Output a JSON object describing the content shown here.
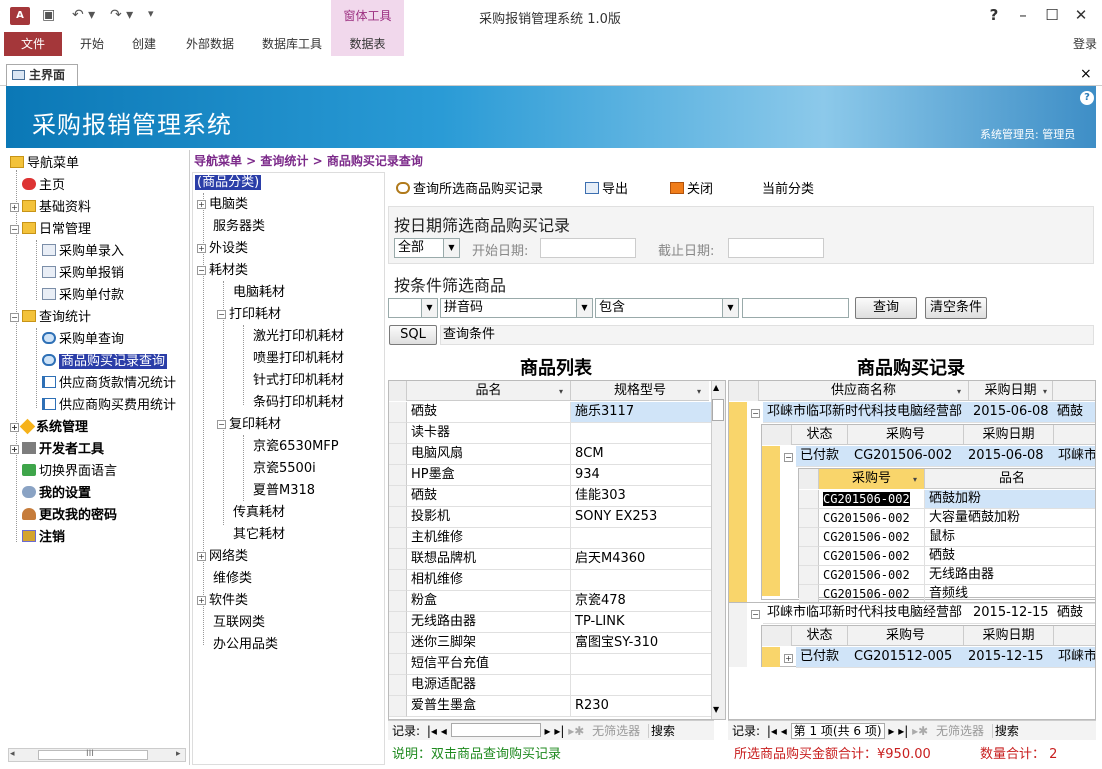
{
  "titlebar": {
    "app_icon": "A",
    "context_tab": "窗体工具",
    "window_title": "采购报销管理系统 1.0版",
    "help": "?",
    "minimize": "–",
    "maximize": "☐",
    "close": "✕"
  },
  "ribbon": {
    "file": "文件",
    "tabs": [
      "开始",
      "创建",
      "外部数据",
      "数据库工具",
      "数据表"
    ],
    "login": "登录"
  },
  "doc_tab": {
    "label": "主界面",
    "close": "×"
  },
  "banner": {
    "title": "采购报销管理系统",
    "user": "系统管理员: 管理员",
    "help": "?"
  },
  "nav": {
    "items": [
      {
        "label": "导航菜单",
        "icon": "folder-icon",
        "level": 0,
        "expander": ""
      },
      {
        "label": "主页",
        "icon": "bug-icon",
        "level": 1,
        "expander": ""
      },
      {
        "label": "基础资料",
        "icon": "folder-icon",
        "level": 1,
        "expander": "+"
      },
      {
        "label": "日常管理",
        "icon": "folder-icon",
        "level": 1,
        "expander": "−"
      },
      {
        "label": "采购单录入",
        "icon": "edit-icon",
        "level": 2,
        "expander": ""
      },
      {
        "label": "采购单报销",
        "icon": "edit-icon",
        "level": 2,
        "expander": ""
      },
      {
        "label": "采购单付款",
        "icon": "pay-icon",
        "level": 2,
        "expander": ""
      },
      {
        "label": "查询统计",
        "icon": "folder-icon",
        "level": 1,
        "expander": "−"
      },
      {
        "label": "采购单查询",
        "icon": "search-icon",
        "level": 2,
        "expander": ""
      },
      {
        "label": "商品购买记录查询",
        "icon": "search-icon",
        "level": 2,
        "expander": "",
        "selected": true
      },
      {
        "label": "供应商货款情况统计",
        "icon": "chart-icon",
        "level": 2,
        "expander": ""
      },
      {
        "label": "供应商购买费用统计",
        "icon": "chart-icon",
        "level": 2,
        "expander": ""
      },
      {
        "label": "系统管理",
        "icon": "star-icon",
        "level": 1,
        "expander": "+",
        "bold": true
      },
      {
        "label": "开发者工具",
        "icon": "tool-icon",
        "level": 1,
        "expander": "+",
        "bold": true
      },
      {
        "label": "切换界面语言",
        "icon": "language-icon",
        "level": 1,
        "expander": ""
      },
      {
        "label": "我的设置",
        "icon": "gear-icon",
        "level": 1,
        "expander": "",
        "bold": true
      },
      {
        "label": "更改我的密码",
        "icon": "user-icon",
        "level": 1,
        "expander": "",
        "bold": true
      },
      {
        "label": "注销",
        "icon": "exit-icon",
        "level": 1,
        "expander": "",
        "bold": true
      }
    ],
    "scroll_mark": "III"
  },
  "breadcrumb": "导航菜单 > 查询统计 > 商品购买记录查询",
  "categories": {
    "items": [
      {
        "label": "(商品分类)",
        "level": 0,
        "expander": "",
        "selected": true
      },
      {
        "label": "电脑类",
        "level": 1,
        "expander": "+"
      },
      {
        "label": "服务器类",
        "level": 1,
        "expander": ""
      },
      {
        "label": "外设类",
        "level": 1,
        "expander": "+"
      },
      {
        "label": "耗材类",
        "level": 1,
        "expander": "−"
      },
      {
        "label": "电脑耗材",
        "level": 2,
        "expander": ""
      },
      {
        "label": "打印耗材",
        "level": 2,
        "expander": "−"
      },
      {
        "label": "激光打印机耗材",
        "level": 3,
        "expander": ""
      },
      {
        "label": "喷墨打印机耗材",
        "level": 3,
        "expander": ""
      },
      {
        "label": "针式打印机耗材",
        "level": 3,
        "expander": ""
      },
      {
        "label": "条码打印机耗材",
        "level": 3,
        "expander": ""
      },
      {
        "label": "复印耗材",
        "level": 2,
        "expander": "−"
      },
      {
        "label": "京瓷6530MFP",
        "level": 3,
        "expander": ""
      },
      {
        "label": "京瓷5500i",
        "level": 3,
        "expander": ""
      },
      {
        "label": "夏普M318",
        "level": 3,
        "expander": ""
      },
      {
        "label": "传真耗材",
        "level": 2,
        "expander": ""
      },
      {
        "label": "其它耗材",
        "level": 2,
        "expander": ""
      },
      {
        "label": "网络类",
        "level": 1,
        "expander": "+"
      },
      {
        "label": "维修类",
        "level": 1,
        "expander": ""
      },
      {
        "label": "软件类",
        "level": 1,
        "expander": "+"
      },
      {
        "label": "互联网类",
        "level": 1,
        "expander": ""
      },
      {
        "label": "办公用品类",
        "level": 1,
        "expander": ""
      }
    ]
  },
  "toolbar": {
    "query": "查询所选商品购买记录",
    "export": "导出",
    "close": "关闭",
    "current_category": "当前分类"
  },
  "date_filter": {
    "title": "按日期筛选商品购买记录",
    "range": "全部",
    "start_label": "开始日期:",
    "end_label": "截止日期:",
    "start_value": "",
    "end_value": ""
  },
  "cond_filter": {
    "title": "按条件筛选商品",
    "field0": "",
    "field": "拼音码",
    "op": "包含",
    "value": "",
    "query_btn": "查询",
    "clear_btn": "清空条件",
    "sql_btn": "SQL",
    "sql_text": "查询条件"
  },
  "product_list": {
    "title": "商品列表",
    "columns": [
      "品名",
      "规格型号"
    ],
    "rows": [
      [
        "硒鼓",
        "施乐3117"
      ],
      [
        "读卡器",
        ""
      ],
      [
        "电脑风扇",
        "8CM"
      ],
      [
        "HP墨盒",
        "934"
      ],
      [
        "硒鼓",
        "佳能303"
      ],
      [
        "投影机",
        "SONY EX253"
      ],
      [
        "主机维修",
        ""
      ],
      [
        "联想品牌机",
        "启天M4360"
      ],
      [
        "相机维修",
        ""
      ],
      [
        "粉盒",
        "京瓷478"
      ],
      [
        "无线路由器",
        "TP-LINK"
      ],
      [
        "迷你三脚架",
        "富图宝SY-310"
      ],
      [
        "短信平台充值",
        ""
      ],
      [
        "电源适配器",
        ""
      ],
      [
        "爱普生墨盒",
        "R230"
      ]
    ],
    "nav_label": "记录:",
    "nav_first": "|◂",
    "nav_prev": "◂",
    "nav_next": "▸",
    "nav_last": "▸|",
    "nav_new": "▸✱",
    "nav_filter": "无筛选器",
    "nav_search": "搜索"
  },
  "purchase_records": {
    "title": "商品购买记录",
    "columns": [
      "供应商名称",
      "采购日期"
    ],
    "groups": [
      {
        "supplier": "邛崃市临邛新时代科技电脑经营部",
        "date": "2015-06-08",
        "extra": "硒鼓",
        "sub_columns": [
          "状态",
          "采购号",
          "采购日期"
        ],
        "sub_row": {
          "status": "已付款",
          "no": "CG201506-002",
          "date": "2015-06-08",
          "extra": "邛崃市"
        },
        "items_columns": [
          "采购号",
          "品名"
        ],
        "items": [
          [
            "CG201506-002",
            "硒鼓加粉"
          ],
          [
            "CG201506-002",
            "大容量硒鼓加粉"
          ],
          [
            "CG201506-002",
            "鼠标"
          ],
          [
            "CG201506-002",
            "硒鼓"
          ],
          [
            "CG201506-002",
            "无线路由器"
          ],
          [
            "CG201506-002",
            "音频线"
          ]
        ]
      },
      {
        "supplier": "邛崃市临邛新时代科技电脑经营部",
        "date": "2015-12-15",
        "extra": "硒鼓",
        "sub_columns": [
          "状态",
          "采购号",
          "采购日期"
        ],
        "sub_row": {
          "status": "已付款",
          "no": "CG201512-005",
          "date": "2015-12-15",
          "extra": "邛崃市"
        }
      }
    ],
    "nav_label": "记录:",
    "nav_first": "|◂",
    "nav_prev": "◂",
    "nav_pos": "第 1 项(共 6 项)",
    "nav_next": "▸",
    "nav_last": "▸|",
    "nav_new": "▸✱",
    "nav_filter": "无筛选器",
    "nav_search": "搜索"
  },
  "footer": {
    "note": "说明：双击商品查询购买记录",
    "sum_label": "所选商品购买金额合计：",
    "sum_value": "¥950.00",
    "count_label": "数量合计：",
    "count_value": "2"
  }
}
